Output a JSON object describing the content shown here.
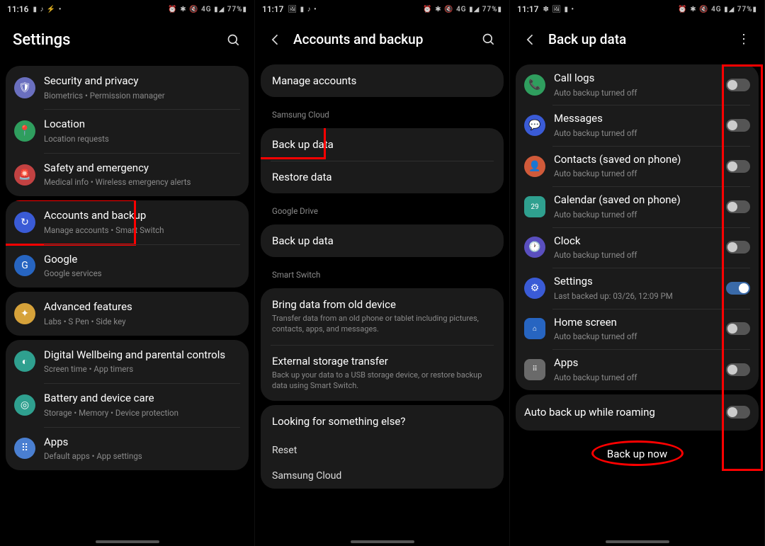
{
  "screens": [
    {
      "status": {
        "time": "11:16",
        "left_icons": "▮ ♪ ⚡ •",
        "right_icons": "⏰ ✱ 🔇 4G ▮◢ 77%▮"
      },
      "title": "Settings",
      "groups": [
        [
          {
            "icon": "🛡",
            "color": "#6a6fbf",
            "title": "Security and privacy",
            "sub": "Biometrics  •  Permission manager"
          },
          {
            "icon": "📍",
            "color": "#2f9e5e",
            "title": "Location",
            "sub": "Location requests"
          },
          {
            "icon": "🚨",
            "color": "#c24242",
            "title": "Safety and emergency",
            "sub": "Medical info  •  Wireless emergency alerts"
          }
        ],
        [
          {
            "icon": "↻",
            "color": "#3a5bd6",
            "title": "Accounts and backup",
            "sub": "Manage accounts  •  Smart Switch",
            "highlight": true
          },
          {
            "icon": "G",
            "color": "#2765c1",
            "title": "Google",
            "sub": "Google services"
          }
        ],
        [
          {
            "icon": "✦",
            "color": "#d6a23a",
            "title": "Advanced features",
            "sub": "Labs  •  S Pen  •  Side key"
          }
        ],
        [
          {
            "icon": "◐",
            "color": "#2fa08f",
            "title": "Digital Wellbeing and parental controls",
            "sub": "Screen time  •  App timers"
          },
          {
            "icon": "◎",
            "color": "#2fa08f",
            "title": "Battery and device care",
            "sub": "Storage  •  Memory  •  Device protection"
          },
          {
            "icon": "⠿",
            "color": "#4a7fd1",
            "title": "Apps",
            "sub": "Default apps  •  App settings"
          }
        ]
      ]
    },
    {
      "status": {
        "time": "11:17",
        "left_icons": "🖼 ▮ ♪ •",
        "right_icons": "⏰ ✱ 🔇 4G ▮◢ 77%▮"
      },
      "title": "Accounts and backup",
      "cards": [
        {
          "rows": [
            {
              "title": "Manage accounts"
            }
          ]
        },
        {
          "label": "Samsung Cloud",
          "rows": [
            {
              "title": "Back up data",
              "highlight": true
            },
            {
              "title": "Restore data"
            }
          ]
        },
        {
          "label": "Google Drive",
          "rows": [
            {
              "title": "Back up data"
            }
          ]
        },
        {
          "label": "Smart Switch",
          "rows": [
            {
              "title": "Bring data from old device",
              "sub": "Transfer data from an old phone or tablet including pictures, contacts, apps, and messages."
            },
            {
              "title": "External storage transfer",
              "sub": "Back up your data to a USB storage device, or restore backup data using Smart Switch."
            }
          ]
        },
        {
          "rows": [
            {
              "title": "Looking for something else?",
              "footer": true
            }
          ]
        }
      ],
      "links": [
        "Reset",
        "Samsung Cloud"
      ]
    },
    {
      "status": {
        "time": "11:17",
        "left_icons": "✽ 🖼 ▮ •",
        "right_icons": "⏰ ✱ 🔇 4G ▮◢ 77%▮"
      },
      "title": "Back up data",
      "items": [
        {
          "icon": "📞",
          "color": "#2f9e5e",
          "title": "Call logs",
          "sub": "Auto backup turned off",
          "on": false
        },
        {
          "icon": "💬",
          "color": "#3a5bd6",
          "title": "Messages",
          "sub": "Auto backup turned off",
          "on": false
        },
        {
          "icon": "👤",
          "color": "#d05a3a",
          "title": "Contacts (saved on phone)",
          "sub": "Auto backup turned off",
          "on": false
        },
        {
          "icon": "29",
          "color": "#2fa08f",
          "sq": true,
          "title": "Calendar (saved on phone)",
          "sub": "Auto backup turned off",
          "on": false
        },
        {
          "icon": "🕐",
          "color": "#5a4fbf",
          "title": "Clock",
          "sub": "Auto backup turned off",
          "on": false
        },
        {
          "icon": "⚙",
          "color": "#3a5bd6",
          "title": "Settings",
          "sub": "Last backed up: 03/26, 12:09 PM",
          "on": true
        },
        {
          "icon": "⌂",
          "color": "#2765c1",
          "sq": true,
          "title": "Home screen",
          "sub": "Auto backup turned off",
          "on": false
        },
        {
          "icon": "⠿",
          "color": "#6a6a6a",
          "sq": true,
          "title": "Apps",
          "sub": "Auto backup turned off",
          "on": false
        }
      ],
      "roaming": {
        "title": "Auto back up while roaming",
        "on": false
      },
      "action": "Back up now"
    }
  ]
}
